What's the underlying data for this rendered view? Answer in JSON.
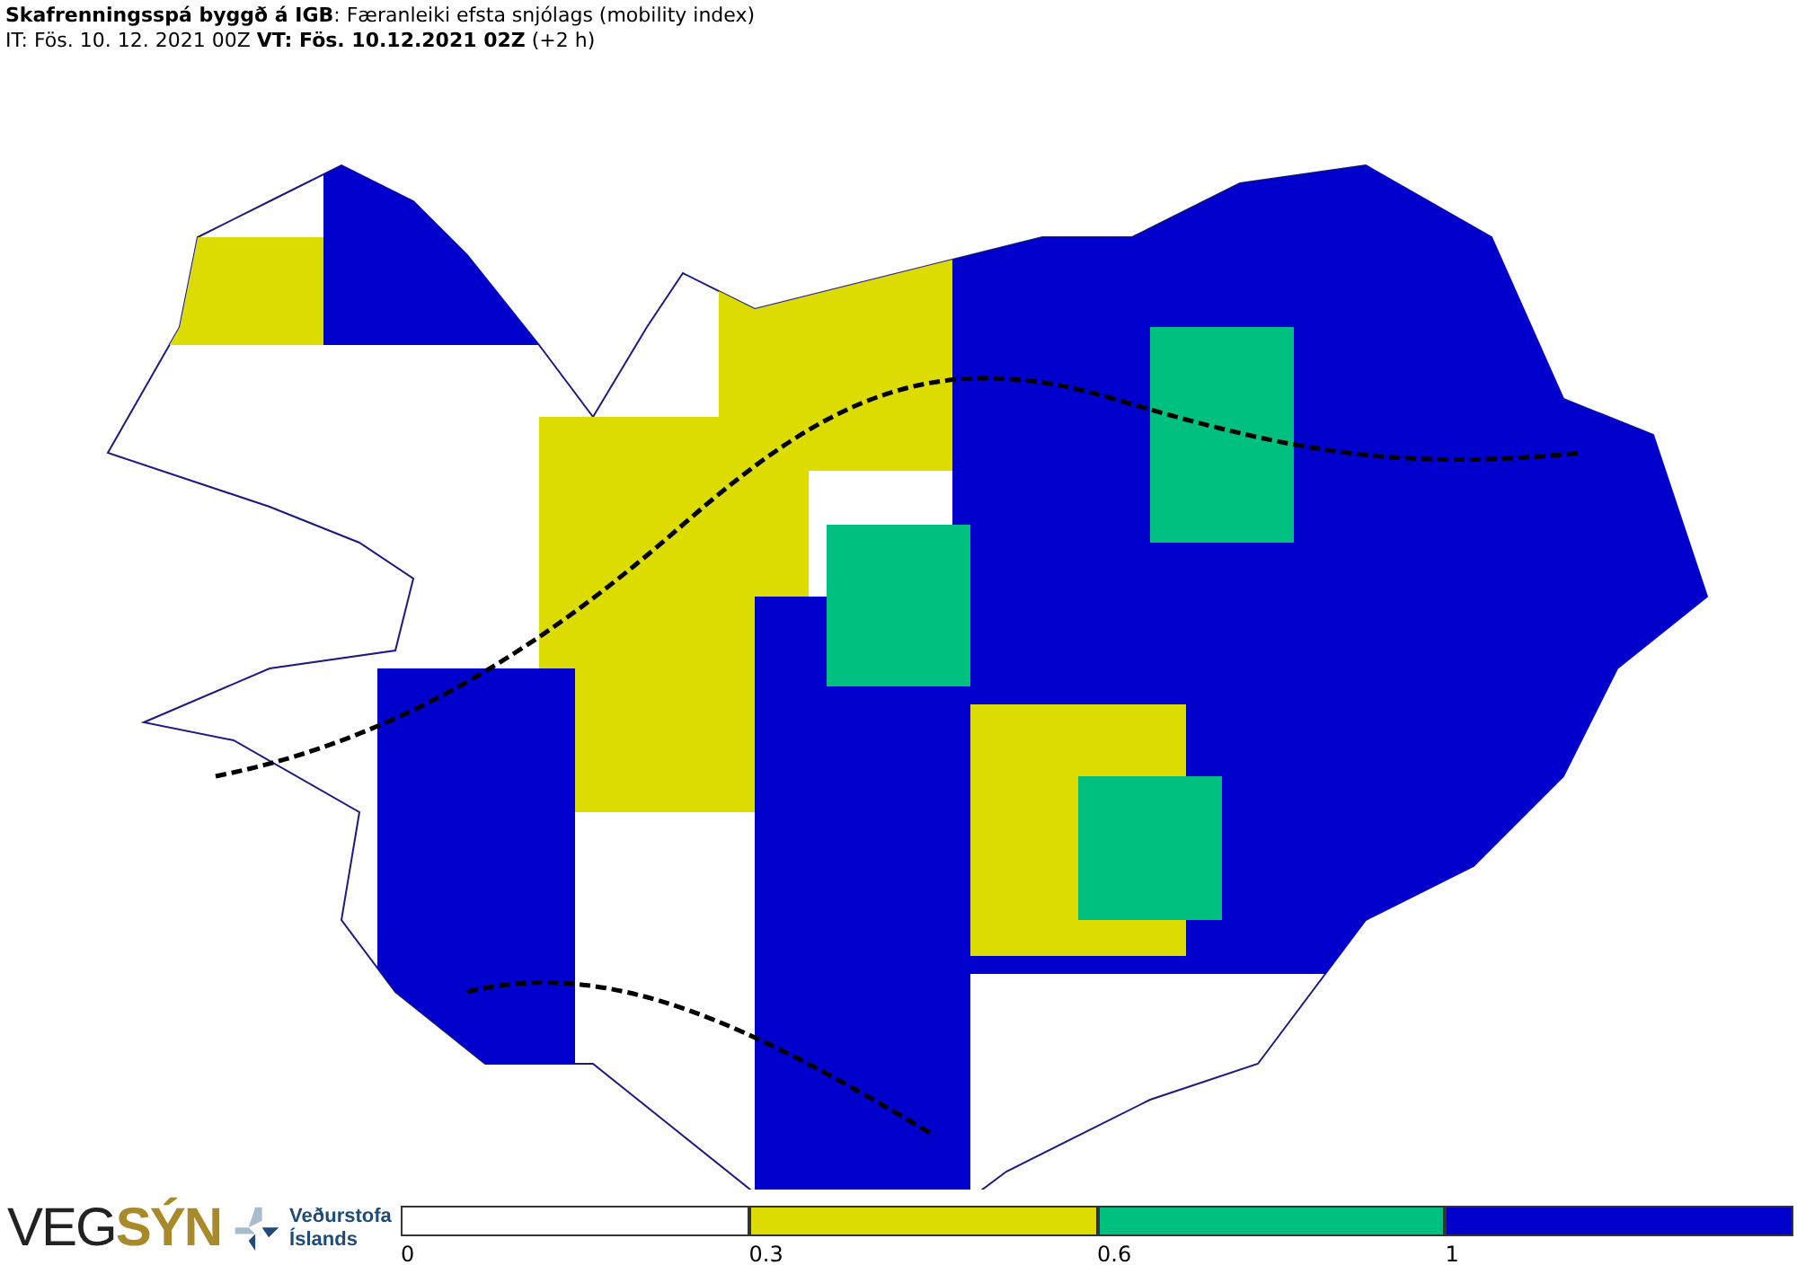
{
  "header": {
    "title": "**Skafrenningsspá byggð á IGB**: Færanleiki efsta snjólags (mobility index)",
    "subtitle": "IT: Fös. 10. 12. 2021 00Z **VT: Fös. 10.12.2021 02Z** (+2 h)"
  },
  "footer": {
    "logo_primary": "VEG",
    "logo_accent": "SÝN",
    "agency": [
      "Veðurstofa",
      "Íslands"
    ]
  },
  "legend": [
    {
      "label": "0",
      "color": "#ffffff"
    },
    {
      "label": "0.3",
      "color": "#dcdc00"
    },
    {
      "label": "0.6",
      "color": "#00c080"
    },
    {
      "label": "1",
      "color": "#0000cc"
    }
  ]
}
